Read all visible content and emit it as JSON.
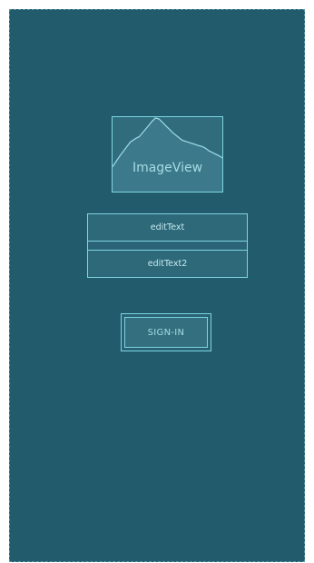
{
  "layout_editor": {
    "image_view": {
      "label": "ImageView",
      "icon": "image-placeholder-icon"
    },
    "edit_text_1": {
      "label": "editText"
    },
    "edit_text_2": {
      "label": "editText2"
    },
    "sign_in_button": {
      "label": "SIGN-IN"
    }
  },
  "colors": {
    "canvas_background": "#225b6c",
    "widget_outline": "#7fd4e2",
    "widget_text": "#a6dbe5"
  }
}
